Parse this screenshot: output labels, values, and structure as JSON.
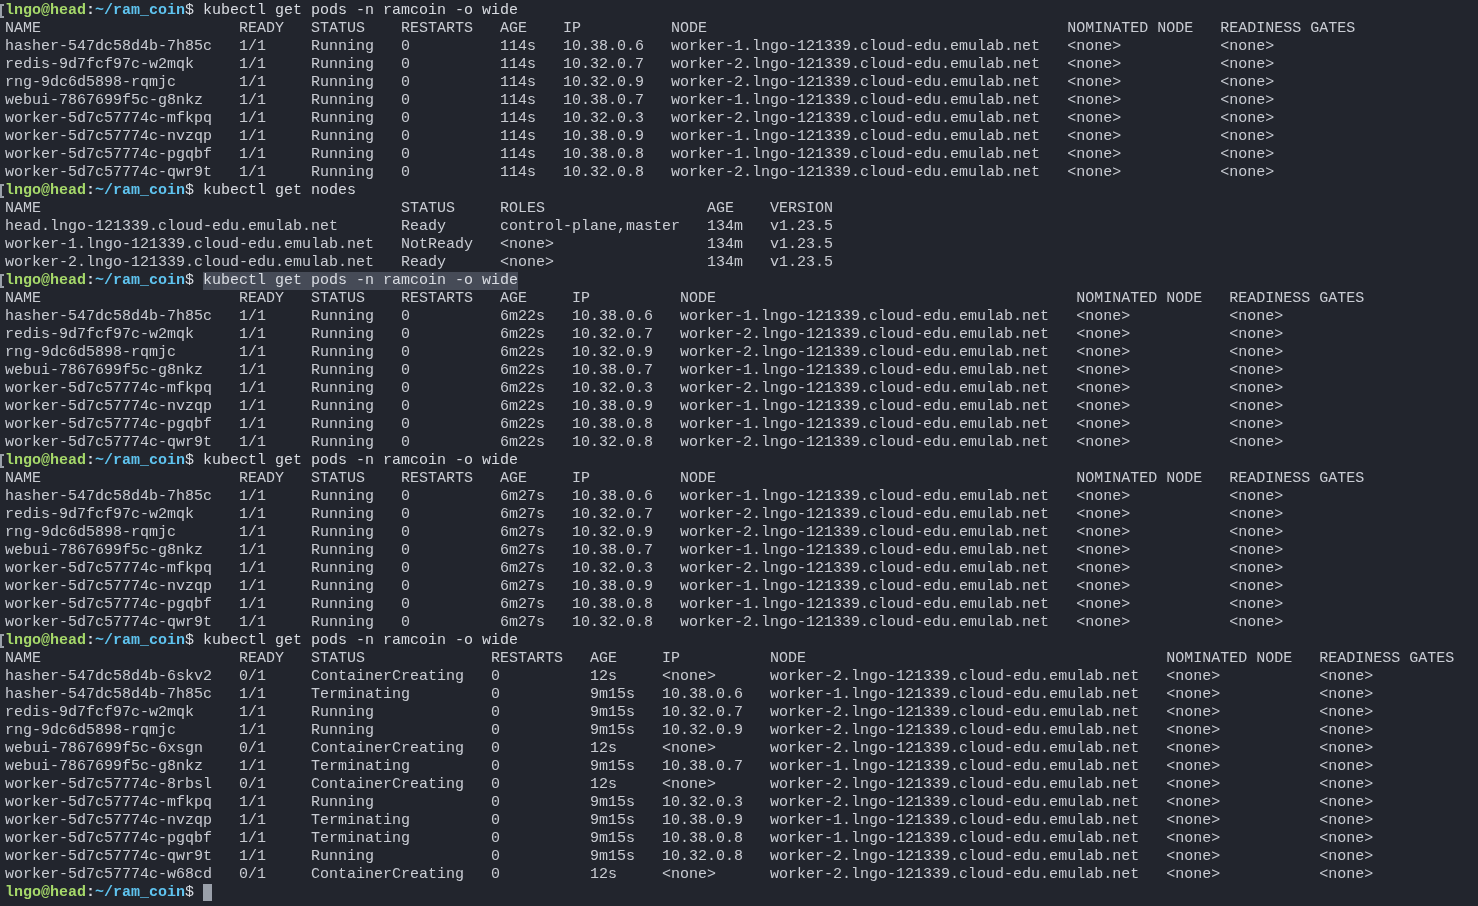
{
  "terminal": {
    "entries": [
      {
        "prompt": {
          "user_host": "lngo@head",
          "separator": ":",
          "path": "~/ram_coin",
          "symbol": "$"
        },
        "marked": true,
        "command": "kubectl get pods -n ramcoin -o wide",
        "selected": false,
        "output": {
          "columns": [
            "NAME",
            "READY",
            "STATUS",
            "RESTARTS",
            "AGE",
            "IP",
            "NODE",
            "NOMINATED NODE",
            "READINESS GATES"
          ],
          "rows": [
            [
              "hasher-547dc58d4b-7h85c",
              "1/1",
              "Running",
              "0",
              "114s",
              "10.38.0.6",
              "worker-1.lngo-121339.cloud-edu.emulab.net",
              "<none>",
              "<none>"
            ],
            [
              "redis-9d7fcf97c-w2mqk",
              "1/1",
              "Running",
              "0",
              "114s",
              "10.32.0.7",
              "worker-2.lngo-121339.cloud-edu.emulab.net",
              "<none>",
              "<none>"
            ],
            [
              "rng-9dc6d5898-rqmjc",
              "1/1",
              "Running",
              "0",
              "114s",
              "10.32.0.9",
              "worker-2.lngo-121339.cloud-edu.emulab.net",
              "<none>",
              "<none>"
            ],
            [
              "webui-7867699f5c-g8nkz",
              "1/1",
              "Running",
              "0",
              "114s",
              "10.38.0.7",
              "worker-1.lngo-121339.cloud-edu.emulab.net",
              "<none>",
              "<none>"
            ],
            [
              "worker-5d7c57774c-mfkpq",
              "1/1",
              "Running",
              "0",
              "114s",
              "10.32.0.3",
              "worker-2.lngo-121339.cloud-edu.emulab.net",
              "<none>",
              "<none>"
            ],
            [
              "worker-5d7c57774c-nvzqp",
              "1/1",
              "Running",
              "0",
              "114s",
              "10.38.0.9",
              "worker-1.lngo-121339.cloud-edu.emulab.net",
              "<none>",
              "<none>"
            ],
            [
              "worker-5d7c57774c-pgqbf",
              "1/1",
              "Running",
              "0",
              "114s",
              "10.38.0.8",
              "worker-1.lngo-121339.cloud-edu.emulab.net",
              "<none>",
              "<none>"
            ],
            [
              "worker-5d7c57774c-qwr9t",
              "1/1",
              "Running",
              "0",
              "114s",
              "10.32.0.8",
              "worker-2.lngo-121339.cloud-edu.emulab.net",
              "<none>",
              "<none>"
            ]
          ]
        }
      },
      {
        "prompt": {
          "user_host": "lngo@head",
          "separator": ":",
          "path": "~/ram_coin",
          "symbol": "$"
        },
        "marked": true,
        "command": "kubectl get nodes",
        "selected": false,
        "output": {
          "columns": [
            "NAME",
            "STATUS",
            "ROLES",
            "AGE",
            "VERSION"
          ],
          "rows": [
            [
              "head.lngo-121339.cloud-edu.emulab.net",
              "Ready",
              "control-plane,master",
              "134m",
              "v1.23.5"
            ],
            [
              "worker-1.lngo-121339.cloud-edu.emulab.net",
              "NotReady",
              "<none>",
              "134m",
              "v1.23.5"
            ],
            [
              "worker-2.lngo-121339.cloud-edu.emulab.net",
              "Ready",
              "<none>",
              "134m",
              "v1.23.5"
            ]
          ]
        }
      },
      {
        "prompt": {
          "user_host": "lngo@head",
          "separator": ":",
          "path": "~/ram_coin",
          "symbol": "$"
        },
        "marked": true,
        "command": "kubectl get pods -n ramcoin -o wide",
        "selected": true,
        "output": {
          "columns": [
            "NAME",
            "READY",
            "STATUS",
            "RESTARTS",
            "AGE",
            "IP",
            "NODE",
            "NOMINATED NODE",
            "READINESS GATES"
          ],
          "rows": [
            [
              "hasher-547dc58d4b-7h85c",
              "1/1",
              "Running",
              "0",
              "6m22s",
              "10.38.0.6",
              "worker-1.lngo-121339.cloud-edu.emulab.net",
              "<none>",
              "<none>"
            ],
            [
              "redis-9d7fcf97c-w2mqk",
              "1/1",
              "Running",
              "0",
              "6m22s",
              "10.32.0.7",
              "worker-2.lngo-121339.cloud-edu.emulab.net",
              "<none>",
              "<none>"
            ],
            [
              "rng-9dc6d5898-rqmjc",
              "1/1",
              "Running",
              "0",
              "6m22s",
              "10.32.0.9",
              "worker-2.lngo-121339.cloud-edu.emulab.net",
              "<none>",
              "<none>"
            ],
            [
              "webui-7867699f5c-g8nkz",
              "1/1",
              "Running",
              "0",
              "6m22s",
              "10.38.0.7",
              "worker-1.lngo-121339.cloud-edu.emulab.net",
              "<none>",
              "<none>"
            ],
            [
              "worker-5d7c57774c-mfkpq",
              "1/1",
              "Running",
              "0",
              "6m22s",
              "10.32.0.3",
              "worker-2.lngo-121339.cloud-edu.emulab.net",
              "<none>",
              "<none>"
            ],
            [
              "worker-5d7c57774c-nvzqp",
              "1/1",
              "Running",
              "0",
              "6m22s",
              "10.38.0.9",
              "worker-1.lngo-121339.cloud-edu.emulab.net",
              "<none>",
              "<none>"
            ],
            [
              "worker-5d7c57774c-pgqbf",
              "1/1",
              "Running",
              "0",
              "6m22s",
              "10.38.0.8",
              "worker-1.lngo-121339.cloud-edu.emulab.net",
              "<none>",
              "<none>"
            ],
            [
              "worker-5d7c57774c-qwr9t",
              "1/1",
              "Running",
              "0",
              "6m22s",
              "10.32.0.8",
              "worker-2.lngo-121339.cloud-edu.emulab.net",
              "<none>",
              "<none>"
            ]
          ]
        }
      },
      {
        "prompt": {
          "user_host": "lngo@head",
          "separator": ":",
          "path": "~/ram_coin",
          "symbol": "$"
        },
        "marked": true,
        "command": "kubectl get pods -n ramcoin -o wide",
        "selected": false,
        "output": {
          "columns": [
            "NAME",
            "READY",
            "STATUS",
            "RESTARTS",
            "AGE",
            "IP",
            "NODE",
            "NOMINATED NODE",
            "READINESS GATES"
          ],
          "rows": [
            [
              "hasher-547dc58d4b-7h85c",
              "1/1",
              "Running",
              "0",
              "6m27s",
              "10.38.0.6",
              "worker-1.lngo-121339.cloud-edu.emulab.net",
              "<none>",
              "<none>"
            ],
            [
              "redis-9d7fcf97c-w2mqk",
              "1/1",
              "Running",
              "0",
              "6m27s",
              "10.32.0.7",
              "worker-2.lngo-121339.cloud-edu.emulab.net",
              "<none>",
              "<none>"
            ],
            [
              "rng-9dc6d5898-rqmjc",
              "1/1",
              "Running",
              "0",
              "6m27s",
              "10.32.0.9",
              "worker-2.lngo-121339.cloud-edu.emulab.net",
              "<none>",
              "<none>"
            ],
            [
              "webui-7867699f5c-g8nkz",
              "1/1",
              "Running",
              "0",
              "6m27s",
              "10.38.0.7",
              "worker-1.lngo-121339.cloud-edu.emulab.net",
              "<none>",
              "<none>"
            ],
            [
              "worker-5d7c57774c-mfkpq",
              "1/1",
              "Running",
              "0",
              "6m27s",
              "10.32.0.3",
              "worker-2.lngo-121339.cloud-edu.emulab.net",
              "<none>",
              "<none>"
            ],
            [
              "worker-5d7c57774c-nvzqp",
              "1/1",
              "Running",
              "0",
              "6m27s",
              "10.38.0.9",
              "worker-1.lngo-121339.cloud-edu.emulab.net",
              "<none>",
              "<none>"
            ],
            [
              "worker-5d7c57774c-pgqbf",
              "1/1",
              "Running",
              "0",
              "6m27s",
              "10.38.0.8",
              "worker-1.lngo-121339.cloud-edu.emulab.net",
              "<none>",
              "<none>"
            ],
            [
              "worker-5d7c57774c-qwr9t",
              "1/1",
              "Running",
              "0",
              "6m27s",
              "10.32.0.8",
              "worker-2.lngo-121339.cloud-edu.emulab.net",
              "<none>",
              "<none>"
            ]
          ]
        }
      },
      {
        "prompt": {
          "user_host": "lngo@head",
          "separator": ":",
          "path": "~/ram_coin",
          "symbol": "$"
        },
        "marked": true,
        "command": "kubectl get pods -n ramcoin -o wide",
        "selected": false,
        "output": {
          "columns": [
            "NAME",
            "READY",
            "STATUS",
            "RESTARTS",
            "AGE",
            "IP",
            "NODE",
            "NOMINATED NODE",
            "READINESS GATES"
          ],
          "rows": [
            [
              "hasher-547dc58d4b-6skv2",
              "0/1",
              "ContainerCreating",
              "0",
              "12s",
              "<none>",
              "worker-2.lngo-121339.cloud-edu.emulab.net",
              "<none>",
              "<none>"
            ],
            [
              "hasher-547dc58d4b-7h85c",
              "1/1",
              "Terminating",
              "0",
              "9m15s",
              "10.38.0.6",
              "worker-1.lngo-121339.cloud-edu.emulab.net",
              "<none>",
              "<none>"
            ],
            [
              "redis-9d7fcf97c-w2mqk",
              "1/1",
              "Running",
              "0",
              "9m15s",
              "10.32.0.7",
              "worker-2.lngo-121339.cloud-edu.emulab.net",
              "<none>",
              "<none>"
            ],
            [
              "rng-9dc6d5898-rqmjc",
              "1/1",
              "Running",
              "0",
              "9m15s",
              "10.32.0.9",
              "worker-2.lngo-121339.cloud-edu.emulab.net",
              "<none>",
              "<none>"
            ],
            [
              "webui-7867699f5c-6xsgn",
              "0/1",
              "ContainerCreating",
              "0",
              "12s",
              "<none>",
              "worker-2.lngo-121339.cloud-edu.emulab.net",
              "<none>",
              "<none>"
            ],
            [
              "webui-7867699f5c-g8nkz",
              "1/1",
              "Terminating",
              "0",
              "9m15s",
              "10.38.0.7",
              "worker-1.lngo-121339.cloud-edu.emulab.net",
              "<none>",
              "<none>"
            ],
            [
              "worker-5d7c57774c-8rbsl",
              "0/1",
              "ContainerCreating",
              "0",
              "12s",
              "<none>",
              "worker-2.lngo-121339.cloud-edu.emulab.net",
              "<none>",
              "<none>"
            ],
            [
              "worker-5d7c57774c-mfkpq",
              "1/1",
              "Running",
              "0",
              "9m15s",
              "10.32.0.3",
              "worker-2.lngo-121339.cloud-edu.emulab.net",
              "<none>",
              "<none>"
            ],
            [
              "worker-5d7c57774c-nvzqp",
              "1/1",
              "Terminating",
              "0",
              "9m15s",
              "10.38.0.9",
              "worker-1.lngo-121339.cloud-edu.emulab.net",
              "<none>",
              "<none>"
            ],
            [
              "worker-5d7c57774c-pgqbf",
              "1/1",
              "Terminating",
              "0",
              "9m15s",
              "10.38.0.8",
              "worker-1.lngo-121339.cloud-edu.emulab.net",
              "<none>",
              "<none>"
            ],
            [
              "worker-5d7c57774c-qwr9t",
              "1/1",
              "Running",
              "0",
              "9m15s",
              "10.32.0.8",
              "worker-2.lngo-121339.cloud-edu.emulab.net",
              "<none>",
              "<none>"
            ],
            [
              "worker-5d7c57774c-w68cd",
              "0/1",
              "ContainerCreating",
              "0",
              "12s",
              "<none>",
              "worker-2.lngo-121339.cloud-edu.emulab.net",
              "<none>",
              "<none>"
            ]
          ]
        }
      },
      {
        "prompt": {
          "user_host": "lngo@head",
          "separator": ":",
          "path": "~/ram_coin",
          "symbol": "$"
        },
        "marked": false,
        "cursor": true
      }
    ]
  }
}
